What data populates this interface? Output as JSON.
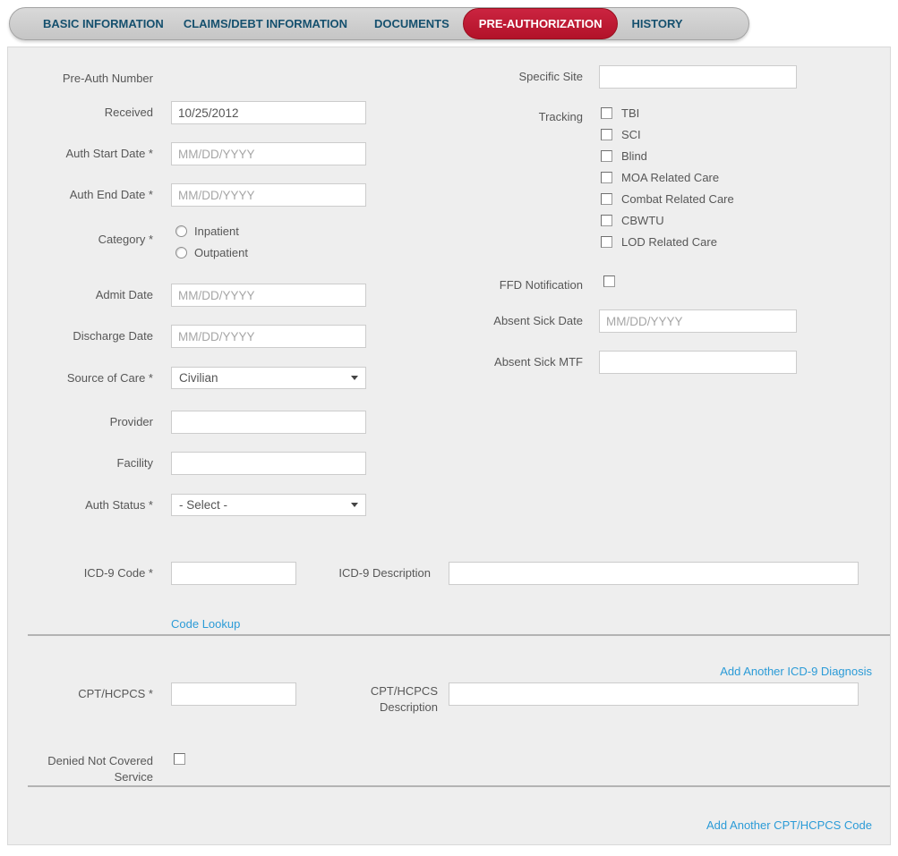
{
  "tabs": [
    {
      "label": "BASIC INFORMATION",
      "active": false
    },
    {
      "label": "CLAIMS/DEBT INFORMATION",
      "active": false
    },
    {
      "label": "DOCUMENTS",
      "active": false
    },
    {
      "label": "PRE-AUTHORIZATION",
      "active": true
    },
    {
      "label": "HISTORY",
      "active": false
    }
  ],
  "colors": {
    "accent_red": "#c11a33",
    "tab_text": "#15506e",
    "link_blue": "#2b9bd7",
    "panel_bg": "#eeeeee"
  },
  "form": {
    "left": {
      "pre_auth_number": {
        "label": "Pre-Auth Number",
        "value": ""
      },
      "received": {
        "label": "Received",
        "value": "10/25/2012"
      },
      "auth_start_date": {
        "label": "Auth Start Date *",
        "placeholder": "MM/DD/YYYY"
      },
      "auth_end_date": {
        "label": "Auth End Date *",
        "placeholder": "MM/DD/YYYY"
      },
      "category": {
        "label": "Category *",
        "options": [
          "Inpatient",
          "Outpatient"
        ]
      },
      "admit_date": {
        "label": "Admit Date",
        "placeholder": "MM/DD/YYYY"
      },
      "discharge_date": {
        "label": "Discharge Date",
        "placeholder": "MM/DD/YYYY"
      },
      "source_of_care": {
        "label": "Source of Care *",
        "value": "Civilian"
      },
      "provider": {
        "label": "Provider",
        "value": ""
      },
      "facility": {
        "label": "Facility",
        "value": ""
      },
      "auth_status": {
        "label": "Auth Status *",
        "value": "- Select -"
      },
      "icd9_code": {
        "label": "ICD-9 Code *",
        "value": ""
      },
      "icd9_description": {
        "label": "ICD-9 Description",
        "value": ""
      },
      "code_lookup_link": "Code Lookup",
      "add_icd9_link": "Add Another ICD-9 Diagnosis",
      "cpt_code": {
        "label": "CPT/HCPCS *",
        "value": ""
      },
      "cpt_description": {
        "label_line1": "CPT/HCPCS",
        "label_line2": "Description",
        "value": ""
      },
      "denied_service": {
        "label_line1": "Denied Not Covered",
        "label_line2": "Service"
      },
      "add_cpt_link": "Add Another CPT/HCPCS Code"
    },
    "right": {
      "specific_site": {
        "label": "Specific Site",
        "value": ""
      },
      "tracking": {
        "label": "Tracking",
        "options": [
          "TBI",
          "SCI",
          "Blind",
          "MOA Related Care",
          "Combat Related Care",
          "CBWTU",
          "LOD Related Care"
        ]
      },
      "ffd_notification": {
        "label": "FFD Notification"
      },
      "absent_sick_date": {
        "label": "Absent Sick Date",
        "placeholder": "MM/DD/YYYY"
      },
      "absent_sick_mtf": {
        "label": "Absent Sick MTF",
        "value": ""
      }
    }
  }
}
